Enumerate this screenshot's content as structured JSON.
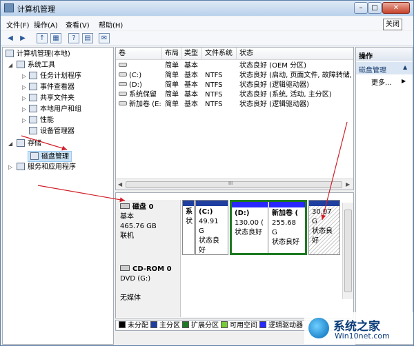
{
  "window": {
    "title": "计算机管理",
    "min": "–",
    "max": "□",
    "close": "✕"
  },
  "menu": [
    "文件(F)",
    "操作(A)",
    "查看(V)",
    "帮助(H)"
  ],
  "tooltip": "关闭",
  "toolbar": [
    "◀",
    "▶",
    "↑",
    "▦",
    "?",
    "▤",
    "✉"
  ],
  "tree": {
    "root": "计算机管理(本地)",
    "system_tools": "系统工具",
    "task_scheduler": "任务计划程序",
    "event_viewer": "事件查看器",
    "shared_folders": "共享文件夹",
    "local_users": "本地用户和组",
    "performance": "性能",
    "device_manager": "设备管理器",
    "storage": "存储",
    "disk_management": "磁盘管理",
    "services": "服务和应用程序"
  },
  "volume_table": {
    "headers": [
      "卷",
      "布局",
      "类型",
      "文件系统",
      "状态"
    ],
    "rows": [
      [
        "",
        "简单",
        "基本",
        "",
        "状态良好 (OEM 分区)"
      ],
      [
        "(C:)",
        "简单",
        "基本",
        "NTFS",
        "状态良好 (启动, 页面文件, 故障转储,"
      ],
      [
        "(D:)",
        "简单",
        "基本",
        "NTFS",
        "状态良好 (逻辑驱动器)"
      ],
      [
        "系统保留",
        "简单",
        "基本",
        "NTFS",
        "状态良好 (系统, 活动, 主分区)"
      ],
      [
        "新加卷 (E:)",
        "简单",
        "基本",
        "NTFS",
        "状态良好 (逻辑驱动器)"
      ]
    ],
    "scroll_marker": "III"
  },
  "disk0": {
    "name": "磁盘 0",
    "type": "基本",
    "size": "465.76 GB",
    "status": "联机",
    "partitions": [
      {
        "label": "系",
        "size": "",
        "status": "状"
      },
      {
        "label": "(C:)",
        "size": "49.91 G",
        "status": "状态良好"
      },
      {
        "label": "(D:)",
        "size": "130.00 (",
        "status": "状态良好"
      },
      {
        "label": "新加卷 (",
        "size": "255.68 G",
        "status": "状态良好"
      },
      {
        "label": "",
        "size": "30.07 G",
        "status": "状态良好"
      }
    ]
  },
  "cdrom": {
    "name": "CD-ROM 0",
    "drive": "DVD (G:)",
    "media": "无媒体"
  },
  "legend": [
    {
      "label": "未分配",
      "color": "#000000"
    },
    {
      "label": "主分区",
      "color": "#1f3fa0"
    },
    {
      "label": "扩展分区",
      "color": "#1e7a22"
    },
    {
      "label": "可用空间",
      "color": "#77cc33"
    },
    {
      "label": "逻辑驱动器",
      "color": "#2828ff"
    }
  ],
  "actions": {
    "header": "操作",
    "section": "磁盘管理",
    "more": "更多...",
    "more_arrow": "▶"
  },
  "watermark": {
    "title": "系统之家",
    "url": "Win10net.com"
  },
  "colors": {
    "primary_bar": "#1f3fa0",
    "logical_bar": "#2828ff",
    "extended": "#1e7a22",
    "arrow": "#d0202a"
  }
}
